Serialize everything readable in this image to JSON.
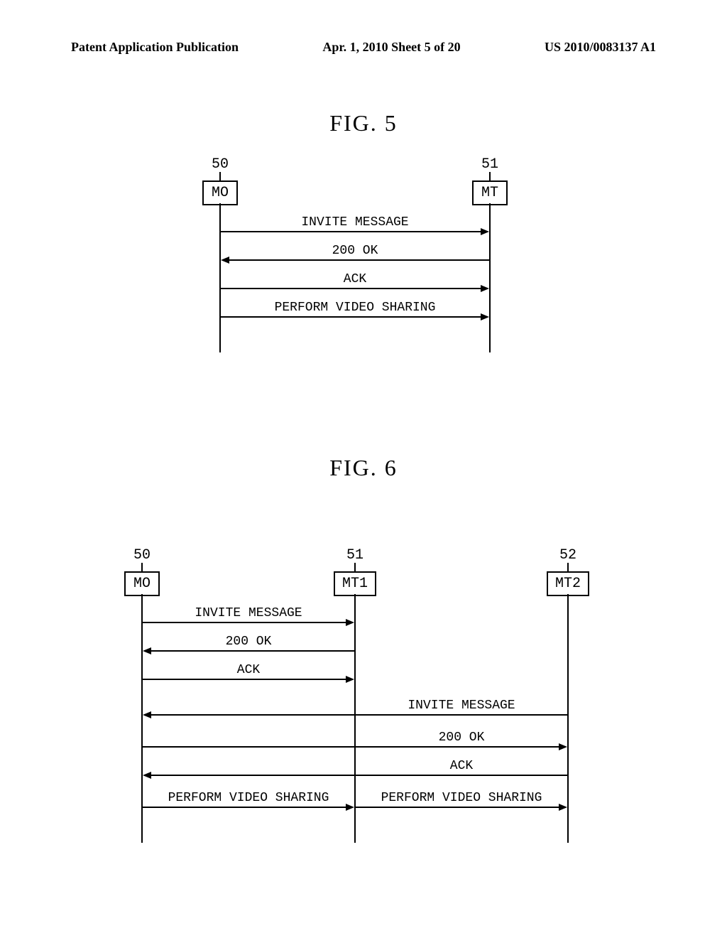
{
  "header": {
    "left": "Patent Application Publication",
    "center": "Apr. 1, 2010  Sheet 5 of 20",
    "right": "US 2010/0083137 A1"
  },
  "fig5": {
    "title": "FIG.  5",
    "nodes": {
      "mo": {
        "num": "50",
        "label": "MO"
      },
      "mt": {
        "num": "51",
        "label": "MT"
      }
    },
    "messages": {
      "m1": "INVITE MESSAGE",
      "m2": "200 OK",
      "m3": "ACK",
      "m4": "PERFORM VIDEO SHARING"
    }
  },
  "fig6": {
    "title": "FIG.  6",
    "nodes": {
      "mo": {
        "num": "50",
        "label": "MO"
      },
      "mt1": {
        "num": "51",
        "label": "MT1"
      },
      "mt2": {
        "num": "52",
        "label": "MT2"
      }
    },
    "messages": {
      "m1": "INVITE MESSAGE",
      "m2": "200 OK",
      "m3": "ACK",
      "m4": "INVITE MESSAGE",
      "m5": "200 OK",
      "m6": "ACK",
      "m7a": "PERFORM VIDEO SHARING",
      "m7b": "PERFORM VIDEO SHARING"
    }
  }
}
